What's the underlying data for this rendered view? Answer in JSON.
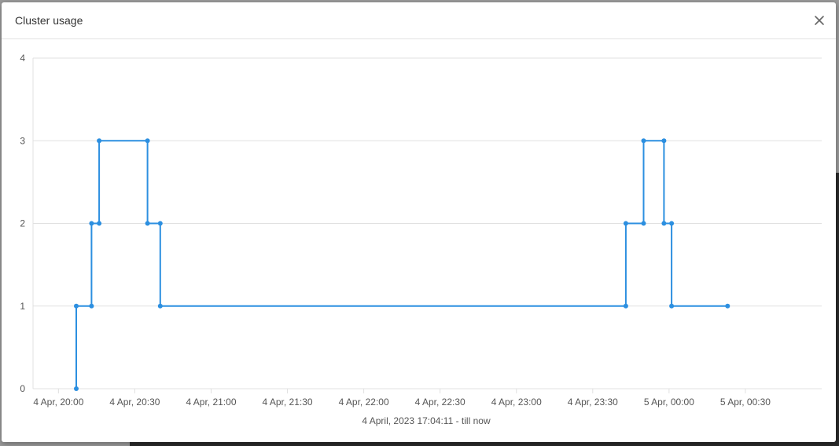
{
  "modal": {
    "title": "Cluster usage",
    "close_icon": "close-icon"
  },
  "colors": {
    "series": "#2c8fe0",
    "grid": "#e0e0e0",
    "axis_text": "#555555"
  },
  "chart_data": {
    "type": "line",
    "step": true,
    "subtitle": "4 April, 2023 17:04:11 - till now",
    "ylim": [
      0,
      4
    ],
    "yticks": [
      0,
      1,
      2,
      3,
      4
    ],
    "xlim": [
      "2023-04-04 19:50",
      "2023-04-05 01:00"
    ],
    "xticks": [
      {
        "t": "2023-04-04 20:00",
        "label": "4 Apr, 20:00"
      },
      {
        "t": "2023-04-04 20:30",
        "label": "4 Apr, 20:30"
      },
      {
        "t": "2023-04-04 21:00",
        "label": "4 Apr, 21:00"
      },
      {
        "t": "2023-04-04 21:30",
        "label": "4 Apr, 21:30"
      },
      {
        "t": "2023-04-04 22:00",
        "label": "4 Apr, 22:00"
      },
      {
        "t": "2023-04-04 22:30",
        "label": "4 Apr, 22:30"
      },
      {
        "t": "2023-04-04 23:00",
        "label": "4 Apr, 23:00"
      },
      {
        "t": "2023-04-04 23:30",
        "label": "4 Apr, 23:30"
      },
      {
        "t": "2023-04-05 00:00",
        "label": "5 Apr, 00:00"
      },
      {
        "t": "2023-04-05 00:30",
        "label": "5 Apr, 00:30"
      }
    ],
    "series": [
      {
        "points": [
          {
            "x": "2023-04-04 20:07",
            "y": 0
          },
          {
            "x": "2023-04-04 20:07",
            "y": 1
          },
          {
            "x": "2023-04-04 20:13",
            "y": 1
          },
          {
            "x": "2023-04-04 20:13",
            "y": 2
          },
          {
            "x": "2023-04-04 20:16",
            "y": 2
          },
          {
            "x": "2023-04-04 20:16",
            "y": 3
          },
          {
            "x": "2023-04-04 20:35",
            "y": 3
          },
          {
            "x": "2023-04-04 20:35",
            "y": 2
          },
          {
            "x": "2023-04-04 20:40",
            "y": 2
          },
          {
            "x": "2023-04-04 20:40",
            "y": 1
          },
          {
            "x": "2023-04-04 23:43",
            "y": 1
          },
          {
            "x": "2023-04-04 23:43",
            "y": 2
          },
          {
            "x": "2023-04-04 23:50",
            "y": 2
          },
          {
            "x": "2023-04-04 23:50",
            "y": 3
          },
          {
            "x": "2023-04-04 23:58",
            "y": 3
          },
          {
            "x": "2023-04-04 23:58",
            "y": 2
          },
          {
            "x": "2023-04-05 00:01",
            "y": 2
          },
          {
            "x": "2023-04-05 00:01",
            "y": 1
          },
          {
            "x": "2023-04-05 00:23",
            "y": 1
          }
        ]
      }
    ]
  }
}
